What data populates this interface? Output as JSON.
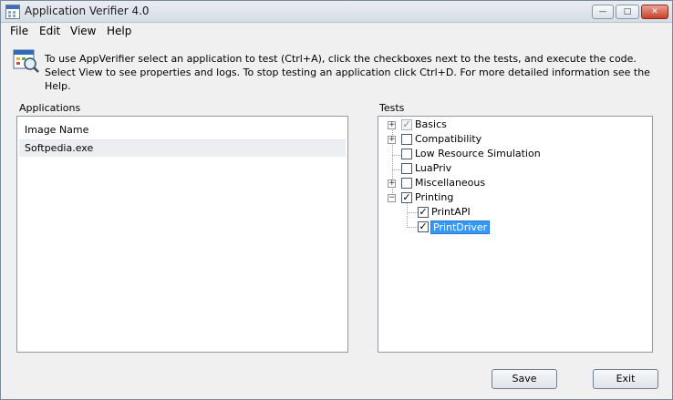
{
  "window": {
    "title": "Application Verifier 4.0",
    "controls": {
      "minimize": "—",
      "maximize": "□",
      "close": "✕"
    }
  },
  "menu": [
    {
      "label": "File"
    },
    {
      "label": "Edit"
    },
    {
      "label": "View"
    },
    {
      "label": "Help"
    }
  ],
  "info": {
    "text": "To use AppVerifier select an application to test (Ctrl+A), click the checkboxes next to the tests, and execute the code. Select View to see properties and logs. To stop testing an application click Ctrl+D. For more detailed information see the Help."
  },
  "applications": {
    "label": "Applications",
    "column_header": "Image Name",
    "rows": [
      "Softpedia.exe"
    ]
  },
  "tests": {
    "label": "Tests",
    "nodes": [
      {
        "label": "Basics",
        "checked": true,
        "disabled": true,
        "expandable": true,
        "expanded": false
      },
      {
        "label": "Compatibility",
        "checked": false,
        "expandable": true,
        "expanded": false
      },
      {
        "label": "Low Resource Simulation",
        "checked": false,
        "expandable": false
      },
      {
        "label": "LuaPriv",
        "checked": false,
        "expandable": false
      },
      {
        "label": "Miscellaneous",
        "checked": false,
        "expandable": true,
        "expanded": false
      },
      {
        "label": "Printing",
        "checked": true,
        "expandable": true,
        "expanded": true,
        "children": [
          {
            "label": "PrintAPI",
            "checked": true
          },
          {
            "label": "PrintDriver",
            "checked": true,
            "selected": true
          }
        ]
      }
    ]
  },
  "buttons": {
    "save": "Save",
    "exit": "Exit"
  },
  "colors": {
    "selection": "#3399ff",
    "window_bg": "#f0f0f0"
  }
}
